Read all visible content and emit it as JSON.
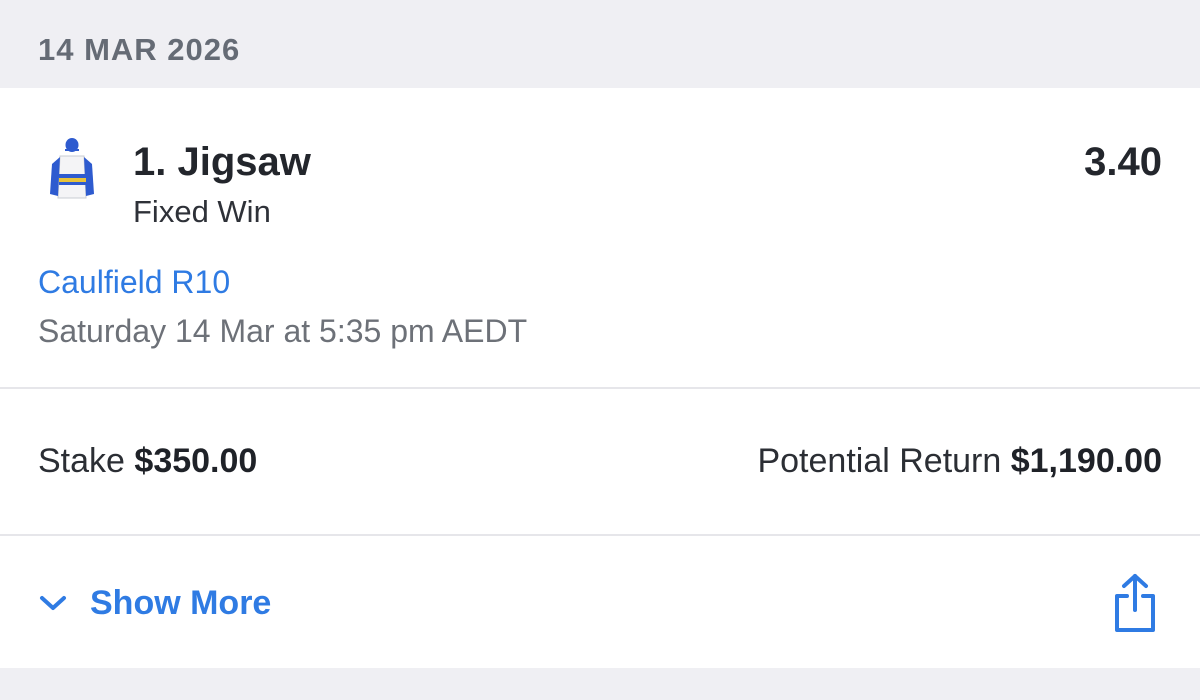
{
  "section": {
    "date": "14 MAR 2026"
  },
  "bet": {
    "runner": "1. Jigsaw",
    "bet_type": "Fixed Win",
    "odds": "3.40",
    "race": "Caulfield R10",
    "race_time": "Saturday 14 Mar at 5:35 pm AEDT",
    "silks_icon": "jockey-silks-icon"
  },
  "stake": {
    "label": "Stake",
    "amount": "$350.00"
  },
  "potential_return": {
    "label": "Potential Return",
    "amount": "$1,190.00"
  },
  "actions": {
    "show_more": "Show More",
    "show_more_icon": "chevron-down-icon",
    "share_icon": "share-icon"
  },
  "colors": {
    "accent": "#2F7BE3",
    "background": "#EFEFF3",
    "card": "#FFFFFF",
    "text_primary": "#23262C",
    "text_secondary": "#6D7178"
  }
}
